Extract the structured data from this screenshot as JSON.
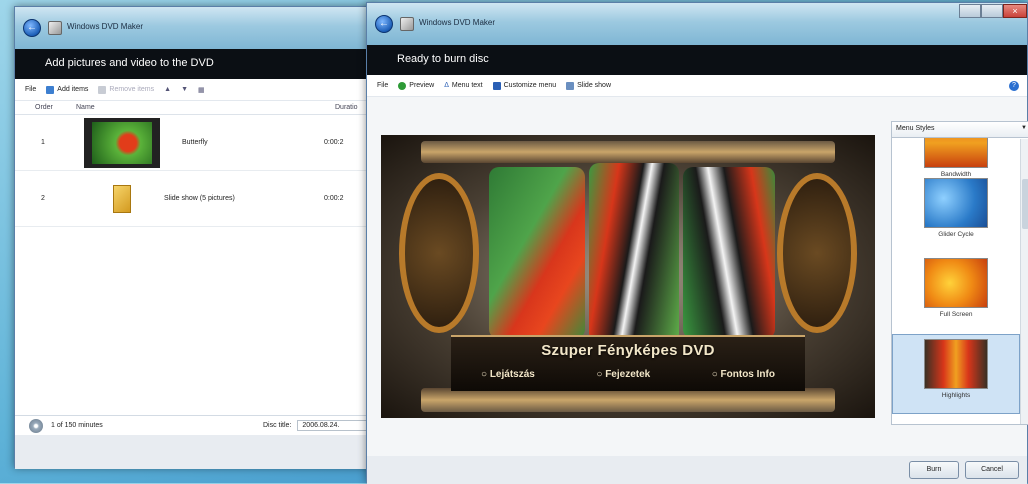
{
  "left_window": {
    "title": "Windows DVD Maker",
    "header": "Add pictures and video to the DVD",
    "toolbar": {
      "file": "File",
      "add_items": "Add items",
      "remove_items": "Remove items"
    },
    "columns": {
      "order": "Order",
      "name": "Name",
      "duration": "Duratio"
    },
    "rows": [
      {
        "order": "1",
        "name": "Butterfly",
        "duration": "0:00:2"
      },
      {
        "order": "2",
        "name": "Slide show (5 pictures)",
        "duration": "0:00:2"
      }
    ],
    "status": {
      "minutes": "1 of 150 minutes",
      "disc_title_label": "Disc title:",
      "disc_title_value": "2006.08.24."
    }
  },
  "right_window": {
    "title": "Windows DVD Maker",
    "header": "Ready to burn disc",
    "toolbar": {
      "file": "File",
      "preview": "Preview",
      "menu_text": "Menu text",
      "customize_menu": "Customize menu",
      "slide_show": "Slide show"
    },
    "preview": {
      "disc_title": "Szuper Fényképes DVD",
      "options": [
        "Lejátszás",
        "Fejezetek",
        "Fontos Info"
      ]
    },
    "styles": {
      "header": "Menu Styles",
      "items": [
        "Bandwidth",
        "Glider Cycle",
        "Full Screen",
        "Highlights"
      ]
    },
    "buttons": {
      "burn": "Burn",
      "cancel": "Cancel"
    }
  },
  "colors": {
    "accent_blue": "#1d5fb8",
    "close_red": "#c9423a",
    "header_black": "#0b0f14"
  }
}
